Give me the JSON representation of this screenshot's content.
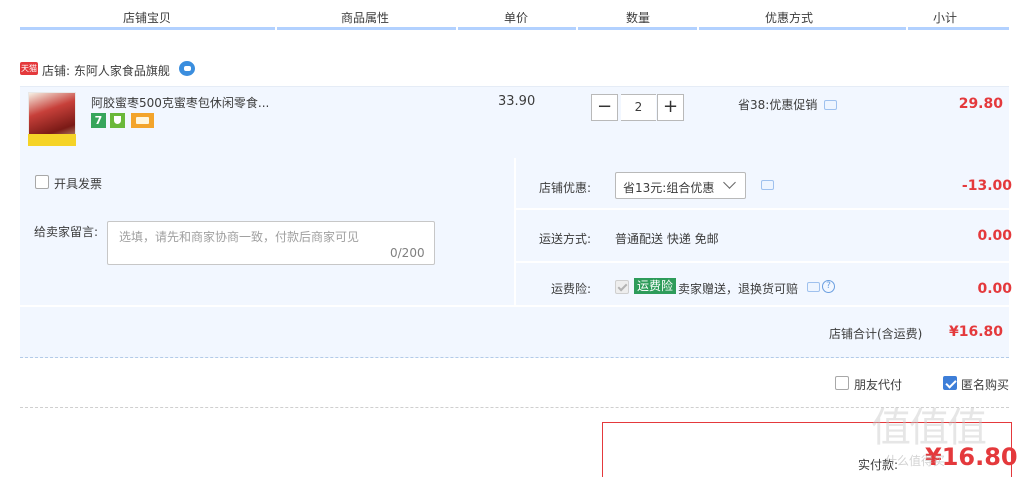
{
  "header": {
    "columns": [
      "店铺宝贝",
      "商品属性",
      "单价",
      "数量",
      "优惠方式",
      "小计"
    ]
  },
  "shop": {
    "logo_text": "天猫",
    "name": "店铺: 东阿人家食品旗舰",
    "chat_icon": "wangwang-icon"
  },
  "item": {
    "title": "阿胶蜜枣500克蜜枣包休闲零食...",
    "service_badge": "7",
    "unit_price": "33.90",
    "quantity": "2",
    "minus_label": "−",
    "plus_label": "+",
    "promotion": "省38:优惠促销",
    "subtotal": "29.80"
  },
  "options": {
    "invoice_label": "开具发票",
    "note_label": "给卖家留言:",
    "note_placeholder": "选填，请先和商家协商一致，付款后商家可见",
    "note_count": "0/200",
    "shop_discount_label": "店铺优惠:",
    "shop_discount_value": "省13元:组合优惠",
    "shop_discount_amount": "-13.00",
    "delivery_label": "运送方式:",
    "delivery_value": "普通配送 快递 免邮",
    "delivery_amount": "0.00",
    "insurance_label": "运费险:",
    "insurance_badge": "运费险",
    "insurance_text": "卖家赠送，退换货可赔",
    "insurance_amount": "0.00",
    "help_glyph": "?"
  },
  "shop_total": {
    "label": "店铺合计(含运费)",
    "amount": "¥16.80"
  },
  "bottom": {
    "friend_pay_label": "朋友代付",
    "anonymous_label": "匿名购买",
    "anonymous_checked": true,
    "pay_label": "实付款:",
    "pay_amount": "¥16.80"
  },
  "watermark": {
    "text": "值值值",
    "sub": "什么值得买"
  },
  "colors": {
    "accent_red": "#e4393c",
    "header_blue": "#b2d1ff",
    "panel_bg": "#f2f7ff",
    "check_blue": "#3d7ed8",
    "badge_green": "#2e9c5a"
  }
}
